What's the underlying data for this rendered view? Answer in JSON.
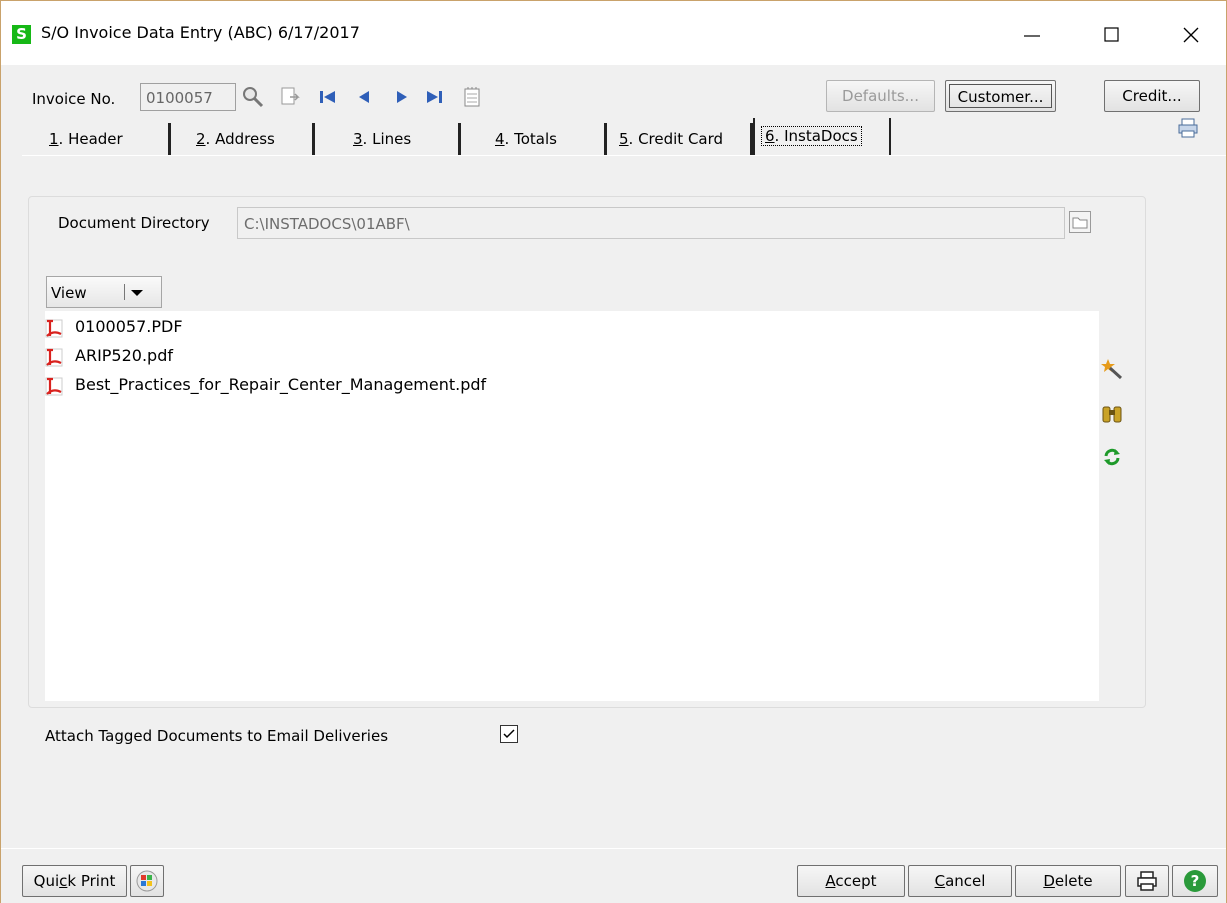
{
  "window": {
    "app_icon_letter": "S",
    "title": "S/O Invoice Data Entry (ABC) 6/17/2017",
    "minimize_icon": "minimize-icon",
    "maximize_icon": "maximize-icon",
    "close_icon": "close-icon"
  },
  "toolbar": {
    "invoice_label_pre": "Invoice No.",
    "invoice_value": "0100057",
    "defaults_label": "Defaults...",
    "customer_label": "Customer...",
    "credit_label": "Credit..."
  },
  "tabs": [
    {
      "key": "1",
      "rest": ". Header"
    },
    {
      "key": "2",
      "rest": ". Address"
    },
    {
      "key": "3",
      "rest": ". Lines"
    },
    {
      "key": "4",
      "rest": ". Totals"
    },
    {
      "key": "5",
      "rest": ". Credit Card"
    },
    {
      "key": "6",
      "rest": ". InstaDocs"
    }
  ],
  "instadocs": {
    "directory_label": "Document Directory",
    "directory_value": "C:\\INSTADOCS\\01ABF\\",
    "view_label": "View",
    "files": [
      {
        "name": "0100057.PDF"
      },
      {
        "name": "ARIP520.pdf"
      },
      {
        "name": "Best_Practices_for_Repair_Center_Management.pdf"
      }
    ],
    "attach_label": "Attach Tagged Documents to Email Deliveries",
    "attach_checked": true
  },
  "bottom": {
    "quick_print_pre": "Qui",
    "quick_print_key": "c",
    "quick_print_post": "k Print",
    "accept_key": "A",
    "accept_rest": "ccept",
    "cancel_key": "C",
    "cancel_rest": "ancel",
    "delete_key": "D",
    "delete_rest": "elete"
  },
  "colors": {
    "app_icon": "#16b816",
    "pdf_red": "#d9221e",
    "help_green": "#2a9a3a"
  }
}
